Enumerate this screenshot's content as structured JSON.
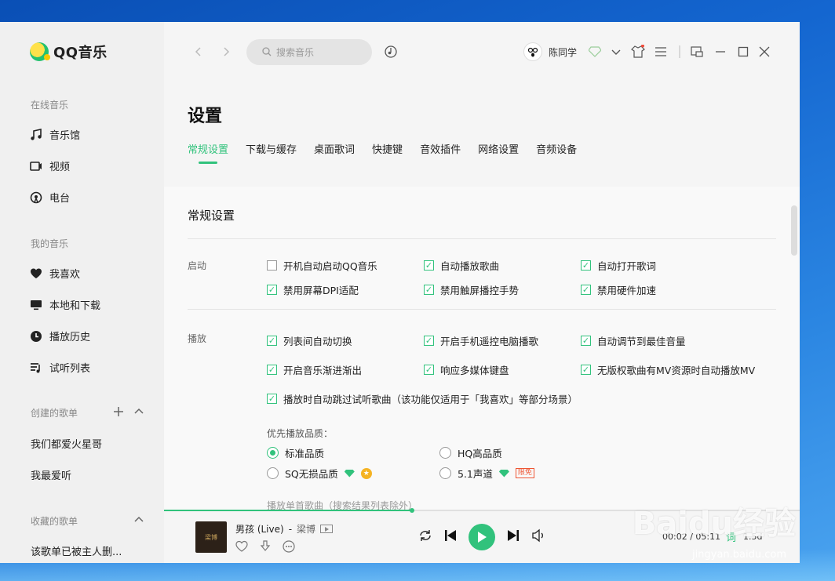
{
  "app": {
    "name": "QQ音乐"
  },
  "sidebar": {
    "online_title": "在线音乐",
    "online_items": [
      {
        "label": "音乐馆",
        "icon": "music-note-icon"
      },
      {
        "label": "视频",
        "icon": "video-icon"
      },
      {
        "label": "电台",
        "icon": "radio-icon"
      }
    ],
    "mine_title": "我的音乐",
    "mine_items": [
      {
        "label": "我喜欢",
        "icon": "heart-icon"
      },
      {
        "label": "本地和下载",
        "icon": "monitor-icon"
      },
      {
        "label": "播放历史",
        "icon": "clock-icon"
      },
      {
        "label": "试听列表",
        "icon": "playlist-icon"
      }
    ],
    "created_title": "创建的歌单",
    "created_items": [
      "我们都爱火星哥",
      "我最爱听"
    ],
    "collected_title": "收藏的歌单",
    "collected_items": [
      "该歌单已被主人删..."
    ]
  },
  "topbar": {
    "search_placeholder": "搜索音乐",
    "username": "陈同学"
  },
  "settings": {
    "title": "设置",
    "tabs": [
      "常规设置",
      "下载与缓存",
      "桌面歌词",
      "快捷键",
      "音效插件",
      "网络设置",
      "音频设备"
    ],
    "active_tab": "常规设置",
    "section_title": "常规设置",
    "startup_label": "启动",
    "startup_options": [
      {
        "label": "开机自动启动QQ音乐",
        "checked": false
      },
      {
        "label": "自动播放歌曲",
        "checked": true
      },
      {
        "label": "自动打开歌词",
        "checked": true
      },
      {
        "label": "禁用屏幕DPI适配",
        "checked": true
      },
      {
        "label": "禁用触屏播控手势",
        "checked": true
      },
      {
        "label": "禁用硬件加速",
        "checked": true
      }
    ],
    "play_label": "播放",
    "play_options": [
      {
        "label": "列表间自动切换",
        "checked": true
      },
      {
        "label": "开启手机遥控电脑播歌",
        "checked": true
      },
      {
        "label": "自动调节到最佳音量",
        "checked": true
      },
      {
        "label": "开启音乐渐进渐出",
        "checked": true
      },
      {
        "label": "响应多媒体键盘",
        "checked": true
      },
      {
        "label": "无版权歌曲有MV资源时自动播放MV",
        "checked": true
      },
      {
        "label": "播放时自动跳过试听歌曲（该功能仅适用于「我喜欢」等部分场景）",
        "checked": true
      }
    ],
    "quality_label": "优先播放品质：",
    "quality_options": [
      {
        "label": "标准品质",
        "selected": true
      },
      {
        "label": "HQ高品质",
        "selected": false
      },
      {
        "label": "SQ无损品质",
        "selected": false
      },
      {
        "label": "5.1声道",
        "selected": false
      }
    ],
    "limit_badge": "限免",
    "cut_text": "播放单首歌曲（搜索结果列表除外）"
  },
  "player": {
    "song": "男孩 (Live)",
    "separator": "-",
    "artist": "梁博",
    "cover_text": "梁博",
    "time": "00:02 / 05:11",
    "lyric": "词",
    "speed": "1.5d",
    "progress": 0.39
  },
  "watermark": {
    "main": "Baidu经验",
    "sub": "jingyan.baidu.com"
  },
  "colors": {
    "accent": "#31c27c"
  }
}
